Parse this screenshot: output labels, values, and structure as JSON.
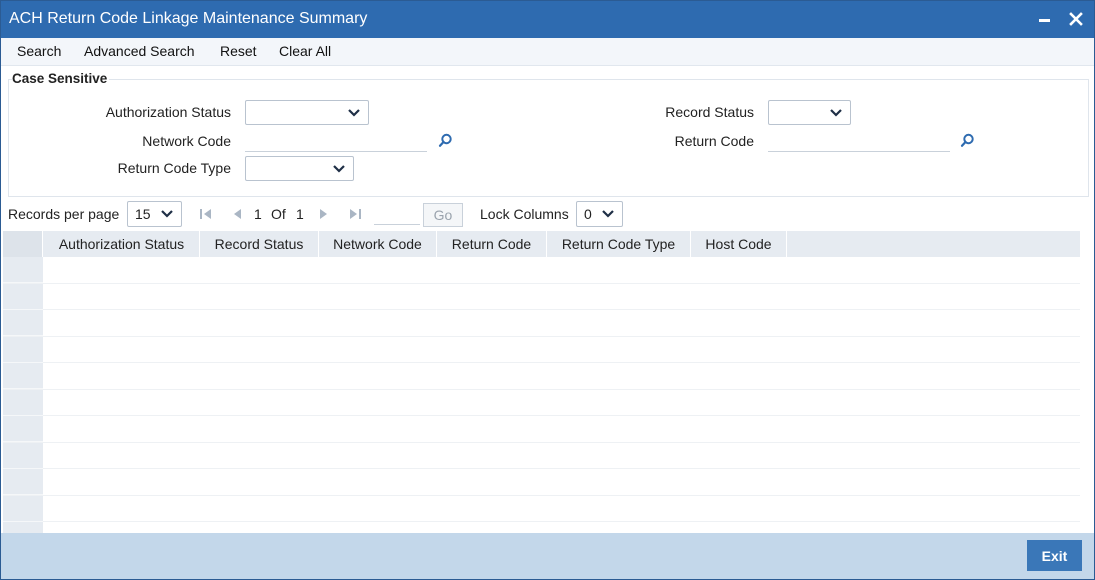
{
  "window": {
    "title": "ACH Return Code Linkage Maintenance Summary"
  },
  "toolbar": {
    "search": "Search",
    "advanced_search": "Advanced Search",
    "reset": "Reset",
    "clear_all": "Clear All"
  },
  "criteria": {
    "legend": "Case Sensitive",
    "authorization_status_label": "Authorization Status",
    "authorization_status_value": "",
    "record_status_label": "Record Status",
    "record_status_value": "",
    "network_code_label": "Network Code",
    "network_code_value": "",
    "return_code_label": "Return Code",
    "return_code_value": "",
    "return_code_type_label": "Return Code Type",
    "return_code_type_value": ""
  },
  "pager": {
    "records_per_page_label": "Records per page",
    "records_per_page_value": "15",
    "current_page": "1",
    "of_label": "Of",
    "total_pages": "1",
    "go_label": "Go",
    "lock_columns_label": "Lock Columns",
    "lock_columns_value": "0"
  },
  "grid": {
    "columns": [
      "Authorization Status",
      "Record Status",
      "Network Code",
      "Return Code",
      "Return Code Type",
      "Host Code"
    ]
  },
  "footer": {
    "exit_label": "Exit"
  },
  "colors": {
    "titlebar": "#2e6bb0",
    "footer": "#c3d7ea",
    "button": "#3a77b8",
    "icon": "#2e6bb0"
  }
}
